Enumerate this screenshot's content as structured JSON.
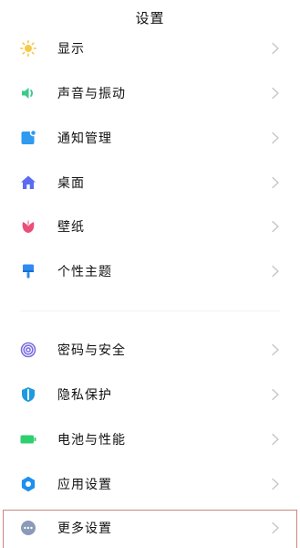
{
  "header": {
    "title": "设置"
  },
  "group1": [
    {
      "label": "显示",
      "icon": "sun-icon",
      "color": "#F7C948"
    },
    {
      "label": "声音与振动",
      "icon": "speaker-icon",
      "color": "#3DC98A"
    },
    {
      "label": "通知管理",
      "icon": "notification-icon",
      "color": "#2E9BF0"
    },
    {
      "label": "桌面",
      "icon": "home-icon",
      "color": "#5B6CF0"
    },
    {
      "label": "壁纸",
      "icon": "flower-icon",
      "color": "#EC4E7A"
    },
    {
      "label": "个性主题",
      "icon": "paintbrush-icon",
      "color": "#2E8BF0"
    }
  ],
  "group2": [
    {
      "label": "密码与安全",
      "icon": "fingerprint-icon",
      "color": "#7A6FE0"
    },
    {
      "label": "隐私保护",
      "icon": "shield-icon",
      "color": "#1E9BE0"
    },
    {
      "label": "电池与性能",
      "icon": "battery-icon",
      "color": "#2ECF6E"
    },
    {
      "label": "应用设置",
      "icon": "gear-icon",
      "color": "#1E90F0"
    },
    {
      "label": "更多设置",
      "icon": "more-icon",
      "color": "#8A9AB8"
    }
  ],
  "highlight_color": "#C8877E"
}
